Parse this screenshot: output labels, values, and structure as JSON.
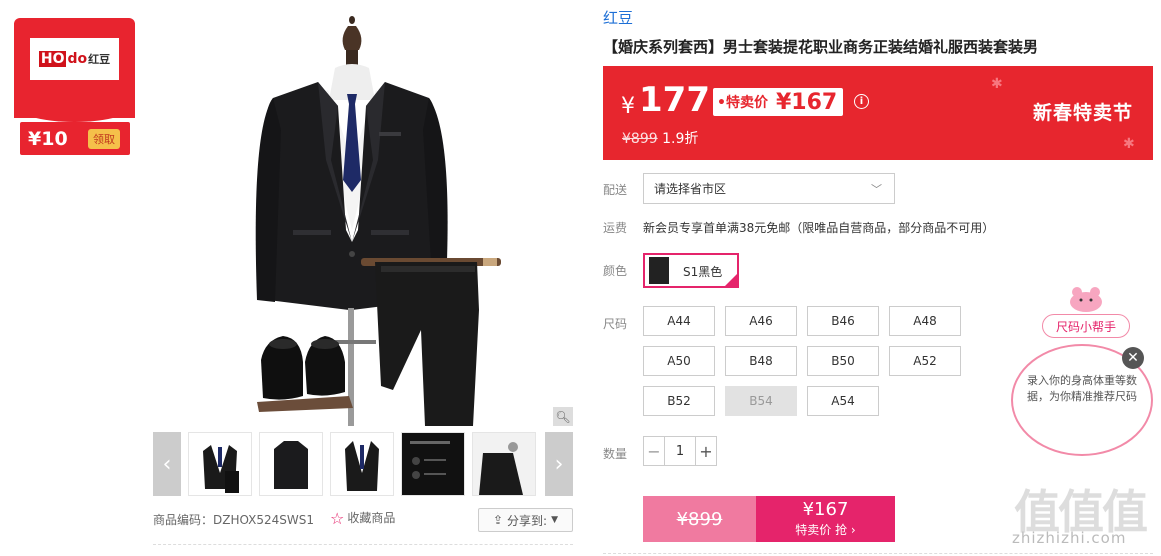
{
  "bookmarks": [
    "",
    "",
    "",
    "",
    "",
    "",
    "",
    "",
    "",
    "",
    "",
    "",
    "",
    "",
    "",
    ""
  ],
  "coupon": {
    "logo_ho": "HO",
    "logo_do": "do",
    "logo_cn": "红豆",
    "value": "¥10",
    "button": "领取"
  },
  "gallery": {
    "prev": "‹",
    "next": "›",
    "zoom_icon": "magnifier-icon",
    "thumb_count": 5
  },
  "product_code_label": "商品编码：DZHOX524SWS1",
  "favorite": {
    "label": "收藏商品"
  },
  "share": {
    "label": "分享到:"
  },
  "brand": "红豆",
  "title": "【婚庆系列套西】男士套装提花职业商务正装结婚礼服西装套装男",
  "price": {
    "currency": "¥",
    "main": "177",
    "special_label": "•特卖价",
    "special_amount": "¥167",
    "original": "¥899",
    "discount": "1.9折",
    "festival": "新春特卖节",
    "accent_color": "#e7262e"
  },
  "labels": {
    "delivery": "配送",
    "shipping": "运费",
    "color": "颜色",
    "size": "尺码",
    "quantity": "数量"
  },
  "delivery": {
    "placeholder": "请选择省市区"
  },
  "shipping_text": "新会员专享首单满38元免邮（限唯品自营商品，部分商品不可用）",
  "color_option": {
    "name": "S1黑色"
  },
  "sizes": [
    {
      "label": "A44",
      "available": true
    },
    {
      "label": "A46",
      "available": true
    },
    {
      "label": "B46",
      "available": true
    },
    {
      "label": "A48",
      "available": true
    },
    {
      "label": "A50",
      "available": true
    },
    {
      "label": "B48",
      "available": true
    },
    {
      "label": "B50",
      "available": true
    },
    {
      "label": "A52",
      "available": true
    },
    {
      "label": "B52",
      "available": true
    },
    {
      "label": "B54",
      "available": false
    },
    {
      "label": "A54",
      "available": true
    }
  ],
  "quantity": {
    "minus": "−",
    "value": "1",
    "plus": "+"
  },
  "buy": {
    "original": "¥899",
    "price": "¥167",
    "cta": "特卖价 抢 ›"
  },
  "size_helper": {
    "title": "尺码小帮手",
    "tip": "录入你的身高体重等数据，为你精准推荐尺码",
    "close": "✕"
  },
  "watermark": {
    "big": "值值值",
    "small": "zhizhizhi.com"
  }
}
